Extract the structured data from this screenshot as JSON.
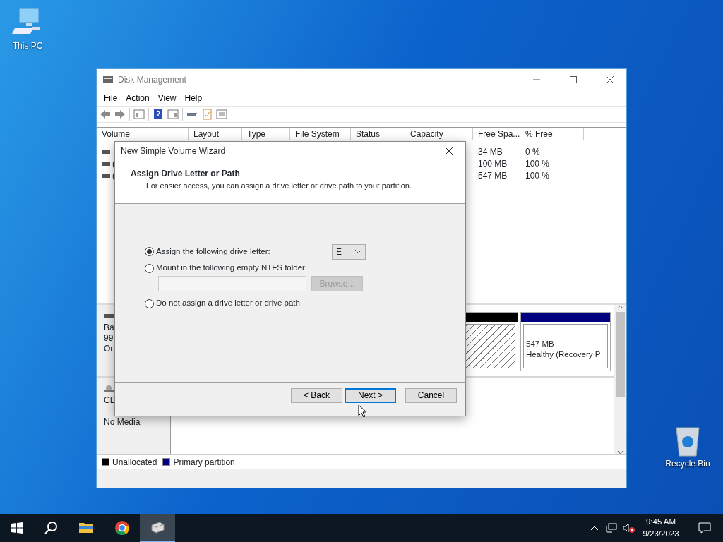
{
  "desktop_icons": [
    {
      "kind": "pc",
      "label": "This PC"
    },
    {
      "kind": "bin",
      "label": "Recycle Bin"
    }
  ],
  "window": {
    "title": "Disk Management",
    "menu": [
      "File",
      "Action",
      "View",
      "Help"
    ],
    "table": {
      "columns": [
        "Volume",
        "Layout",
        "Type",
        "File System",
        "Status",
        "Capacity",
        "Free Spa...",
        "% Free"
      ],
      "rows": [
        {
          "free_space": "34 MB",
          "pct_free": "0 %"
        },
        {
          "volume": "(",
          "free_space": "100 MB",
          "pct_free": "100 %"
        },
        {
          "volume": "(",
          "free_space": "547 MB",
          "pct_free": "100 %"
        }
      ]
    },
    "disks": [
      {
        "kind": "disk",
        "label_lines": [
          "Ba",
          "99.",
          "On"
        ],
        "partitions": [
          {
            "kind": "unallocated",
            "selected": true
          },
          {
            "kind": "primary",
            "selected": false,
            "size": "547 MB",
            "status": "Healthy (Recovery P"
          }
        ]
      },
      {
        "kind": "cdrom",
        "label_lines": [
          "CD"
        ],
        "note": "No Media"
      }
    ],
    "legend": [
      {
        "label": "Unallocated",
        "color": "#000000"
      },
      {
        "label": "Primary partition",
        "color": "#000080"
      }
    ]
  },
  "dialog": {
    "title": "New Simple Volume Wizard",
    "heading": "Assign Drive Letter or Path",
    "subheading": "For easier access, you can assign a drive letter or drive path to your partition.",
    "options": [
      {
        "kind": "letter",
        "label": "Assign the following drive letter:",
        "selected": true
      },
      {
        "kind": "folder",
        "label": "Mount in the following empty NTFS folder:",
        "selected": false
      },
      {
        "kind": "none",
        "label": "Do not assign a drive letter or drive path",
        "selected": false
      }
    ],
    "drive_letter": "E",
    "browse": {
      "label": "Browse...",
      "disabled": true
    },
    "buttons": [
      {
        "label": "< Back",
        "focused": false
      },
      {
        "label": "Next >",
        "focused": true
      },
      {
        "label": "Cancel",
        "focused": false
      }
    ]
  },
  "taskbar": {
    "apps": [
      {
        "kind": "explorer",
        "active": false
      },
      {
        "kind": "chrome",
        "active": false
      },
      {
        "kind": "diskmgmt",
        "active": true
      }
    ],
    "time": "9:45 AM",
    "date": "9/23/2023"
  }
}
